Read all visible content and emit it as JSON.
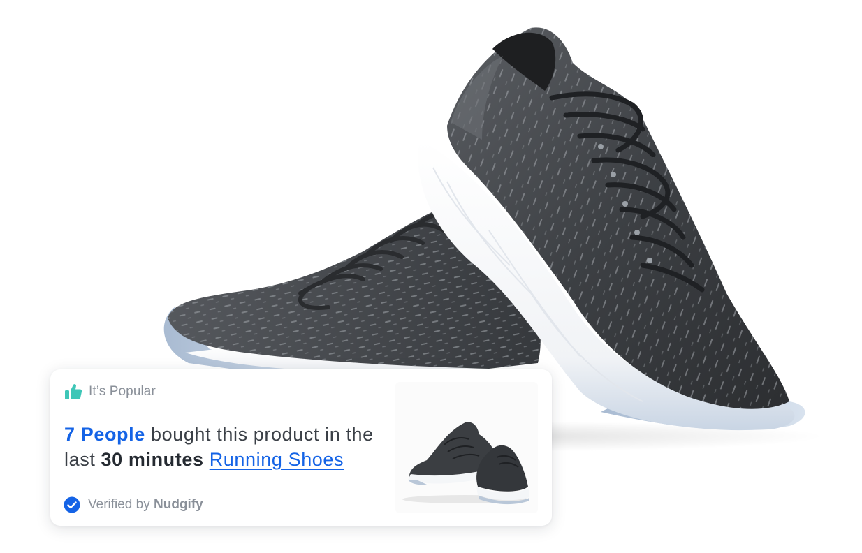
{
  "notification": {
    "tag_label": "It’s Popular",
    "count": "7 People",
    "message_start": "bought this product in the last",
    "duration": "30 minutes",
    "product_name": "Running Shoes",
    "verified_prefix": "Verified by",
    "verified_brand": "Nudgify"
  },
  "icons": {
    "tag_icon": "thumbs-up-icon",
    "verified_icon": "check-badge-icon"
  },
  "colors": {
    "accent_blue": "#1463e6",
    "teal_icon": "#3ec6b7",
    "muted_text": "#8a9099",
    "body_text": "#3b4047",
    "card_background": "#ffffff"
  }
}
